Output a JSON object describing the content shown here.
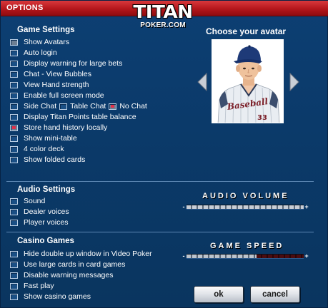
{
  "window": {
    "title": "OPTIONS"
  },
  "logo": {
    "main": "TITAN",
    "sub": "POKER.COM"
  },
  "game_settings": {
    "title": "Game Settings",
    "options": [
      {
        "label": "Show Avatars",
        "checked": true,
        "mark": "grey"
      },
      {
        "label": "Auto login",
        "checked": false
      },
      {
        "label": "Display warning for large bets",
        "checked": false
      },
      {
        "label": "Chat - View Bubbles",
        "checked": false
      },
      {
        "label": "View Hand strength",
        "checked": false
      },
      {
        "label": "Enable full screen mode",
        "checked": false
      }
    ],
    "chat_row": [
      {
        "label": "Side Chat",
        "checked": false
      },
      {
        "label": "Table Chat",
        "checked": false
      },
      {
        "label": "No Chat",
        "checked": true,
        "mark": "red"
      }
    ],
    "options_after": [
      {
        "label": "Display Titan Points table balance",
        "checked": false
      },
      {
        "label": "Store hand history locally",
        "checked": true,
        "mark": "red"
      },
      {
        "label": "Show mini-table",
        "checked": false
      },
      {
        "label": "4 color deck",
        "checked": false
      },
      {
        "label": "Show folded cards",
        "checked": false
      }
    ]
  },
  "avatar": {
    "title": "Choose your avatar",
    "jersey_text": "Baseball",
    "jersey_number": "33"
  },
  "audio_settings": {
    "title": "Audio Settings",
    "options": [
      {
        "label": "Sound",
        "checked": false
      },
      {
        "label": "Dealer voices",
        "checked": false
      },
      {
        "label": "Player voices",
        "checked": false
      }
    ],
    "volume": {
      "title": "AUDIO VOLUME",
      "minus": "-",
      "plus": "+",
      "level": 1.0
    }
  },
  "casino_games": {
    "title": "Casino Games",
    "options": [
      {
        "label": "Hide double up window in Video Poker",
        "checked": false
      },
      {
        "label": "Use large cards in card games",
        "checked": false
      },
      {
        "label": "Disable warning messages",
        "checked": false
      },
      {
        "label": "Fast play",
        "checked": false
      },
      {
        "label": "Show casino games",
        "checked": false
      }
    ],
    "speed": {
      "title": "GAME SPEED",
      "minus": "-",
      "plus": "+",
      "level": 0.6
    }
  },
  "buttons": {
    "ok": "ok",
    "cancel": "cancel"
  },
  "colors": {
    "title_red": "#b4161b",
    "background_blue": "#0b3a6b",
    "checked_red": "#e2304a"
  }
}
